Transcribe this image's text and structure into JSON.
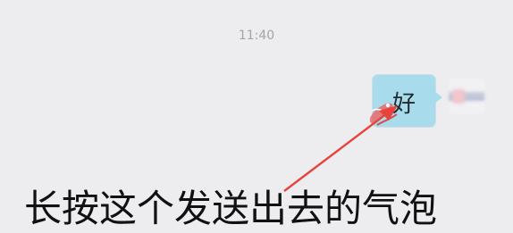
{
  "chat": {
    "timestamp": "11:40",
    "sent_message": {
      "text": "好",
      "bubble_color": "#a8dcec"
    }
  },
  "annotation": {
    "caption": "长按这个发送出去的气泡",
    "arrow_color": "#e8423c"
  },
  "icons": {
    "avatar": "user-avatar-blurred",
    "press_marker": "long-press-marker-icon",
    "arrow": "red-pointer-arrow"
  }
}
